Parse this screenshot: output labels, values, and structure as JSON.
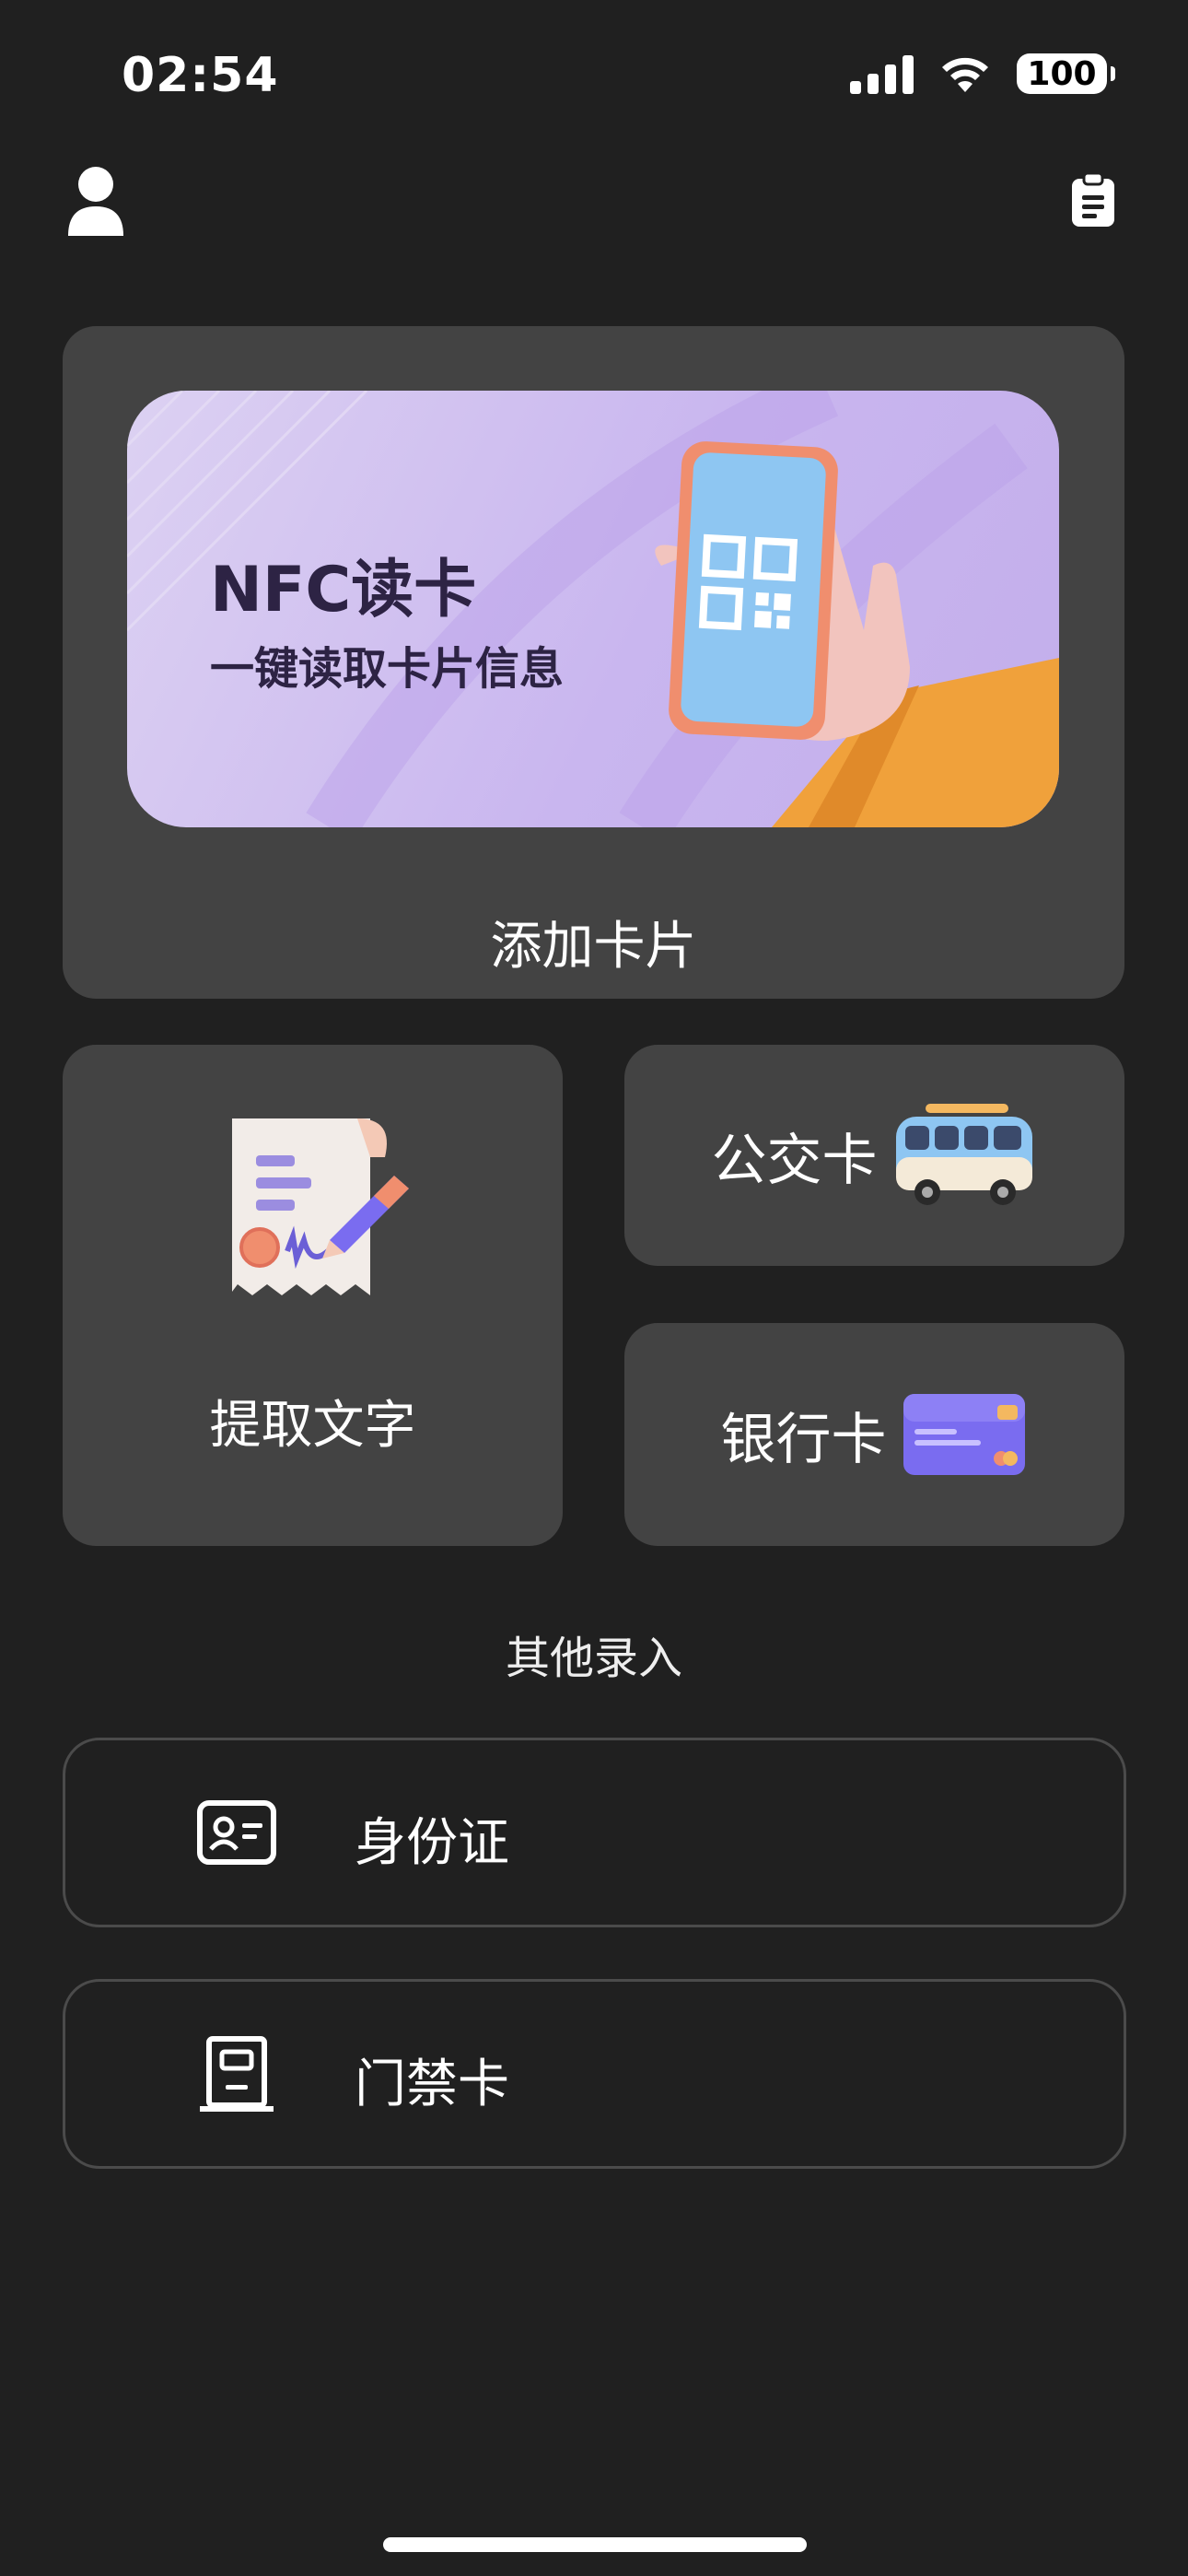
{
  "status_bar": {
    "time": "02:54",
    "battery": "100"
  },
  "header": {
    "left_icon": "user-icon",
    "right_icon": "clipboard-icon"
  },
  "banner": {
    "title": "NFC读卡",
    "subtitle": "一键读取卡片信息",
    "button_label": "添加卡片"
  },
  "tiles": {
    "extract_text": "提取文字",
    "bus_card": "公交卡",
    "bank_card": "银行卡"
  },
  "other": {
    "title": "其他录入",
    "items": [
      {
        "label": "身份证",
        "icon": "id-card-icon"
      },
      {
        "label": "门禁卡",
        "icon": "door-icon"
      }
    ]
  }
}
